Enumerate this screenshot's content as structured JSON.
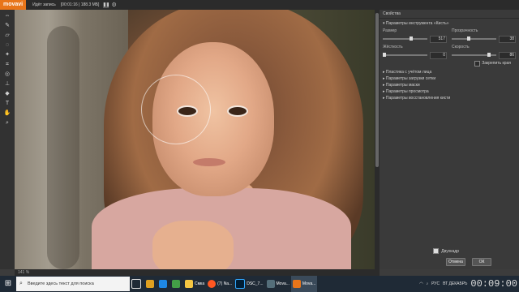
{
  "app": {
    "logo": "movavi",
    "recording": "Идёт запись",
    "rec_time": "[00:01:16 | 188.3 МБ]"
  },
  "tools": [
    "move-icon",
    "brush-icon",
    "eraser-icon",
    "lasso-icon",
    "wand-icon",
    "crop-icon",
    "clone-icon",
    "stamp-icon",
    "bucket-icon",
    "text-icon",
    "hand-icon",
    "zoom-icon"
  ],
  "panel": {
    "title": "Свойства",
    "brush_section": "Параметры инструмента «Кисть»",
    "size_label": "Размер",
    "size_value": "517",
    "opacity_label": "Прозрачность",
    "opacity_value": "38",
    "hardness_label": "Жёсткость",
    "hardness_value": "0",
    "speed_label": "Скорость",
    "speed_value": "86",
    "fix_edges_label": "Закрепить края",
    "collapsed": [
      "Пластика с учётом лица",
      "Параметры загрузки сетки",
      "Параметры маски",
      "Параметры просмотра",
      "Параметры восстановления кисти"
    ],
    "mirror_label": "Двухкадр",
    "cancel": "Отмена",
    "ok": "ОК"
  },
  "status": {
    "zoom": "141 %"
  },
  "taskbar": {
    "search_placeholder": "Введите здесь текст для поиска",
    "items": [
      {
        "label": "",
        "color": "#e0a020"
      },
      {
        "label": "",
        "color": "#1e88e5"
      },
      {
        "label": "",
        "color": "#43a047"
      },
      {
        "label": "Смка",
        "color": "#f4c542"
      },
      {
        "label": "(7) Na...",
        "color": "#ff5722"
      },
      {
        "label": "DSC_7...",
        "color": "#001e36"
      },
      {
        "label": "Movа...",
        "color": "#546e7a"
      },
      {
        "label": "Movа...",
        "color": "#e8751a"
      }
    ],
    "lang": "РУС",
    "date": "ВТ ДЕКАБРЬ",
    "time": "00:09:00"
  },
  "colors": {
    "accent": "#e8751a",
    "panel_bg": "#3a3a3a",
    "taskbar_bg": "#1f2a36"
  }
}
